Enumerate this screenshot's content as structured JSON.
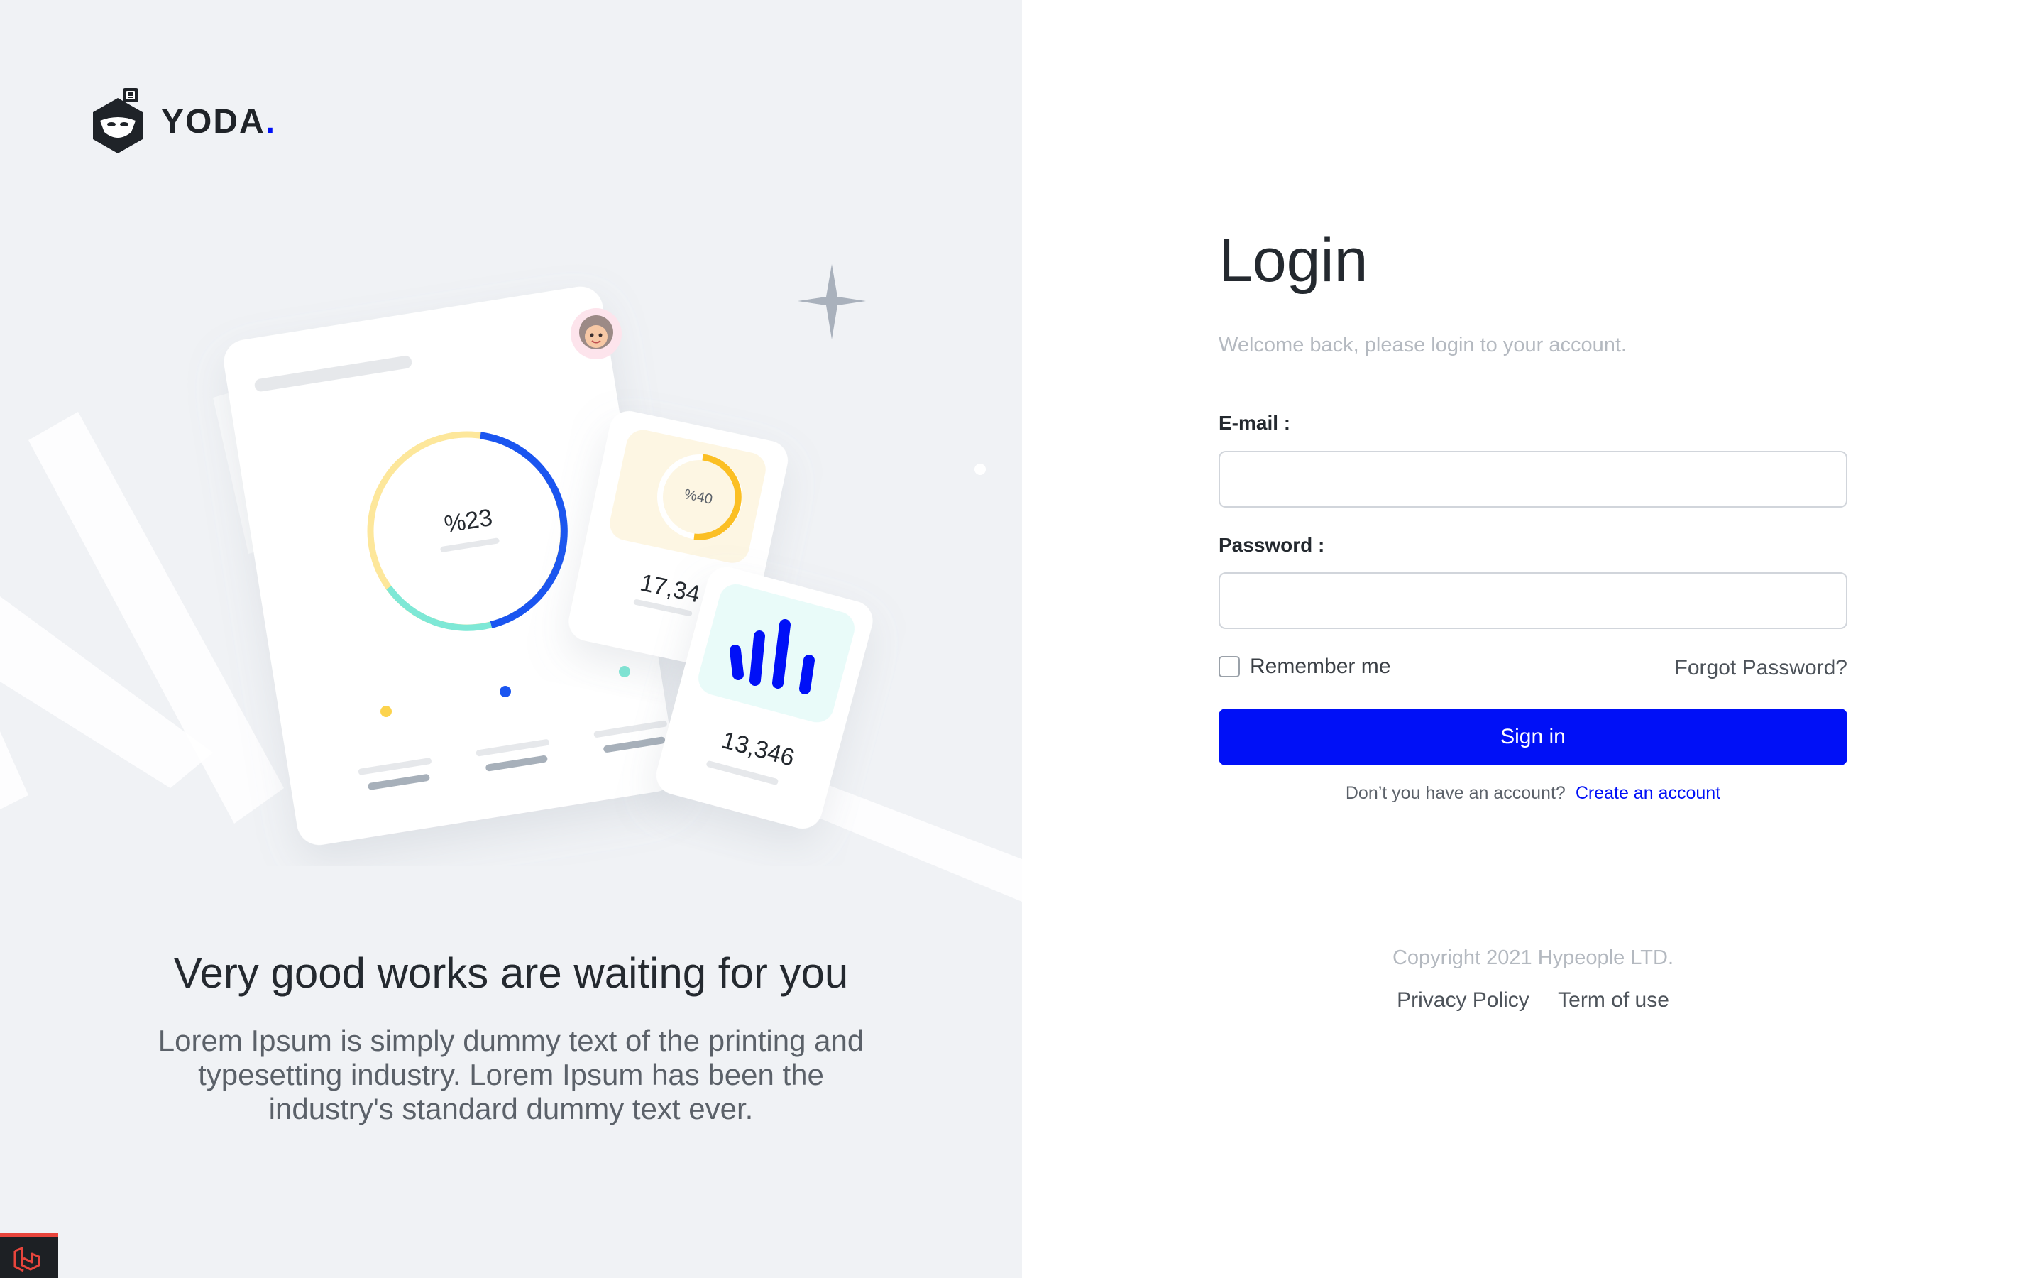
{
  "brand": {
    "name": "YODA",
    "dot": ".",
    "accent_color": "#0010f7"
  },
  "hero": {
    "tagline": "Very good works are waiting for you",
    "description": "Lorem Ipsum is simply dummy text of the printing and typesetting industry. Lorem Ipsum has been the industry's standard dummy text ever."
  },
  "illustration": {
    "donut_label": "%23",
    "small_gauge_label": "%40",
    "card_value_1": "17,34",
    "card_value_2": "13,346"
  },
  "login": {
    "title": "Login",
    "subtitle": "Welcome back, please login to your account.",
    "email_label": "E-mail :",
    "email_value": "",
    "password_label": "Password :",
    "password_value": "",
    "remember_label": "Remember me",
    "remember_checked": false,
    "forgot_label": "Forgot Password?",
    "signin_label": "Sign in",
    "no_account_text": "Don’t you have an account?",
    "create_account_label": "Create an account"
  },
  "footer": {
    "copyright": "Copyright 2021 Hypeople LTD.",
    "privacy_label": "Privacy Policy",
    "terms_label": "Term of use"
  },
  "icons": {
    "logo": "ninja-shield-icon",
    "sparkle": "star-sparkle-icon",
    "avatar": "avatar-face-icon",
    "corner": "laravel-icon"
  }
}
